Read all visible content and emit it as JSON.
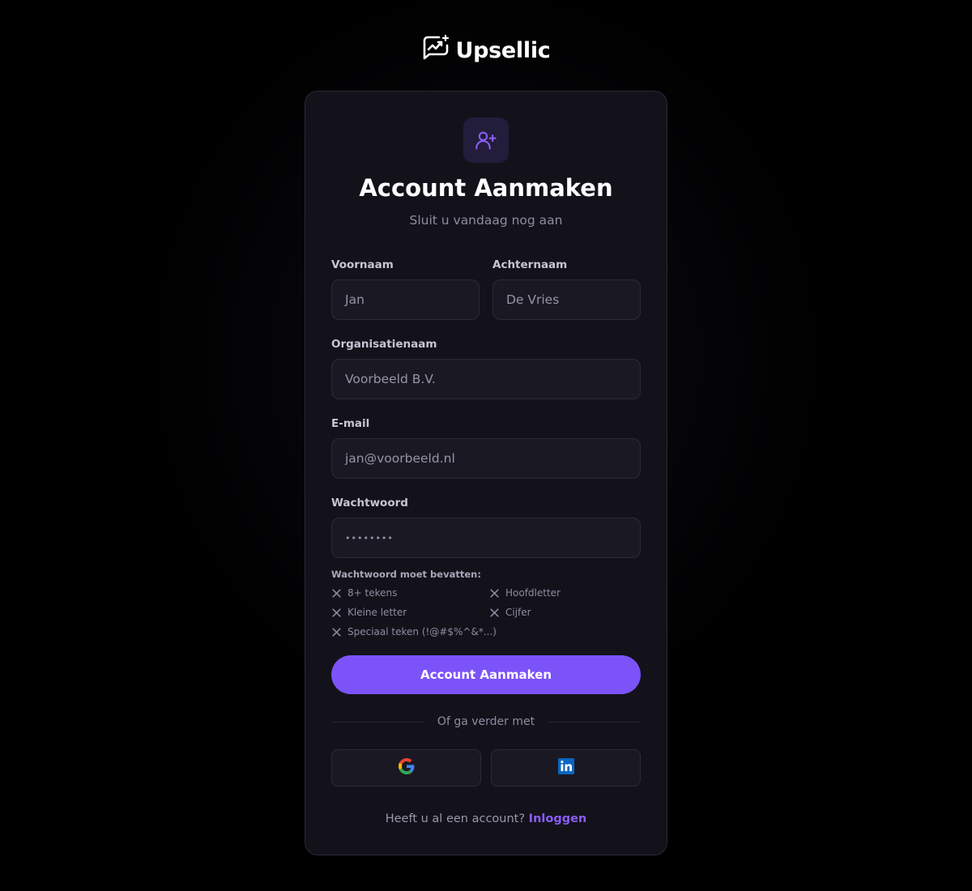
{
  "brand": {
    "name": "Upsellic",
    "logo_icon": "chart-chat-logo-icon"
  },
  "header": {
    "icon": "user-plus-icon",
    "title": "Account Aanmaken",
    "subtitle": "Sluit u vandaag nog aan"
  },
  "form": {
    "first_name": {
      "label": "Voornaam",
      "placeholder": "Jan"
    },
    "last_name": {
      "label": "Achternaam",
      "placeholder": "De Vries"
    },
    "organisation": {
      "label": "Organisatienaam",
      "placeholder": "Voorbeeld B.V."
    },
    "email": {
      "label": "E-mail",
      "placeholder": "jan@voorbeeld.nl"
    },
    "password": {
      "label": "Wachtwoord",
      "placeholder": "••••••••"
    }
  },
  "requirements": {
    "title": "Wachtwoord moet bevatten:",
    "items": [
      "8+ tekens",
      "Hoofdletter",
      "Kleine letter",
      "Cijfer",
      "Speciaal teken (!@#$%^&*...)"
    ],
    "status_icon": "x-icon"
  },
  "submit_label": "Account Aanmaken",
  "divider_text": "Of ga verder met",
  "social": [
    {
      "provider_icon": "google-icon",
      "color": "#4285F4"
    },
    {
      "provider_icon": "linkedin-icon",
      "color": "#0A66C2"
    }
  ],
  "footer": {
    "text": "Heeft u al een account?",
    "link": "Inloggen"
  },
  "colors": {
    "accent": "#7c53f8",
    "card": "#13121b",
    "link": "#8b5cf6"
  }
}
